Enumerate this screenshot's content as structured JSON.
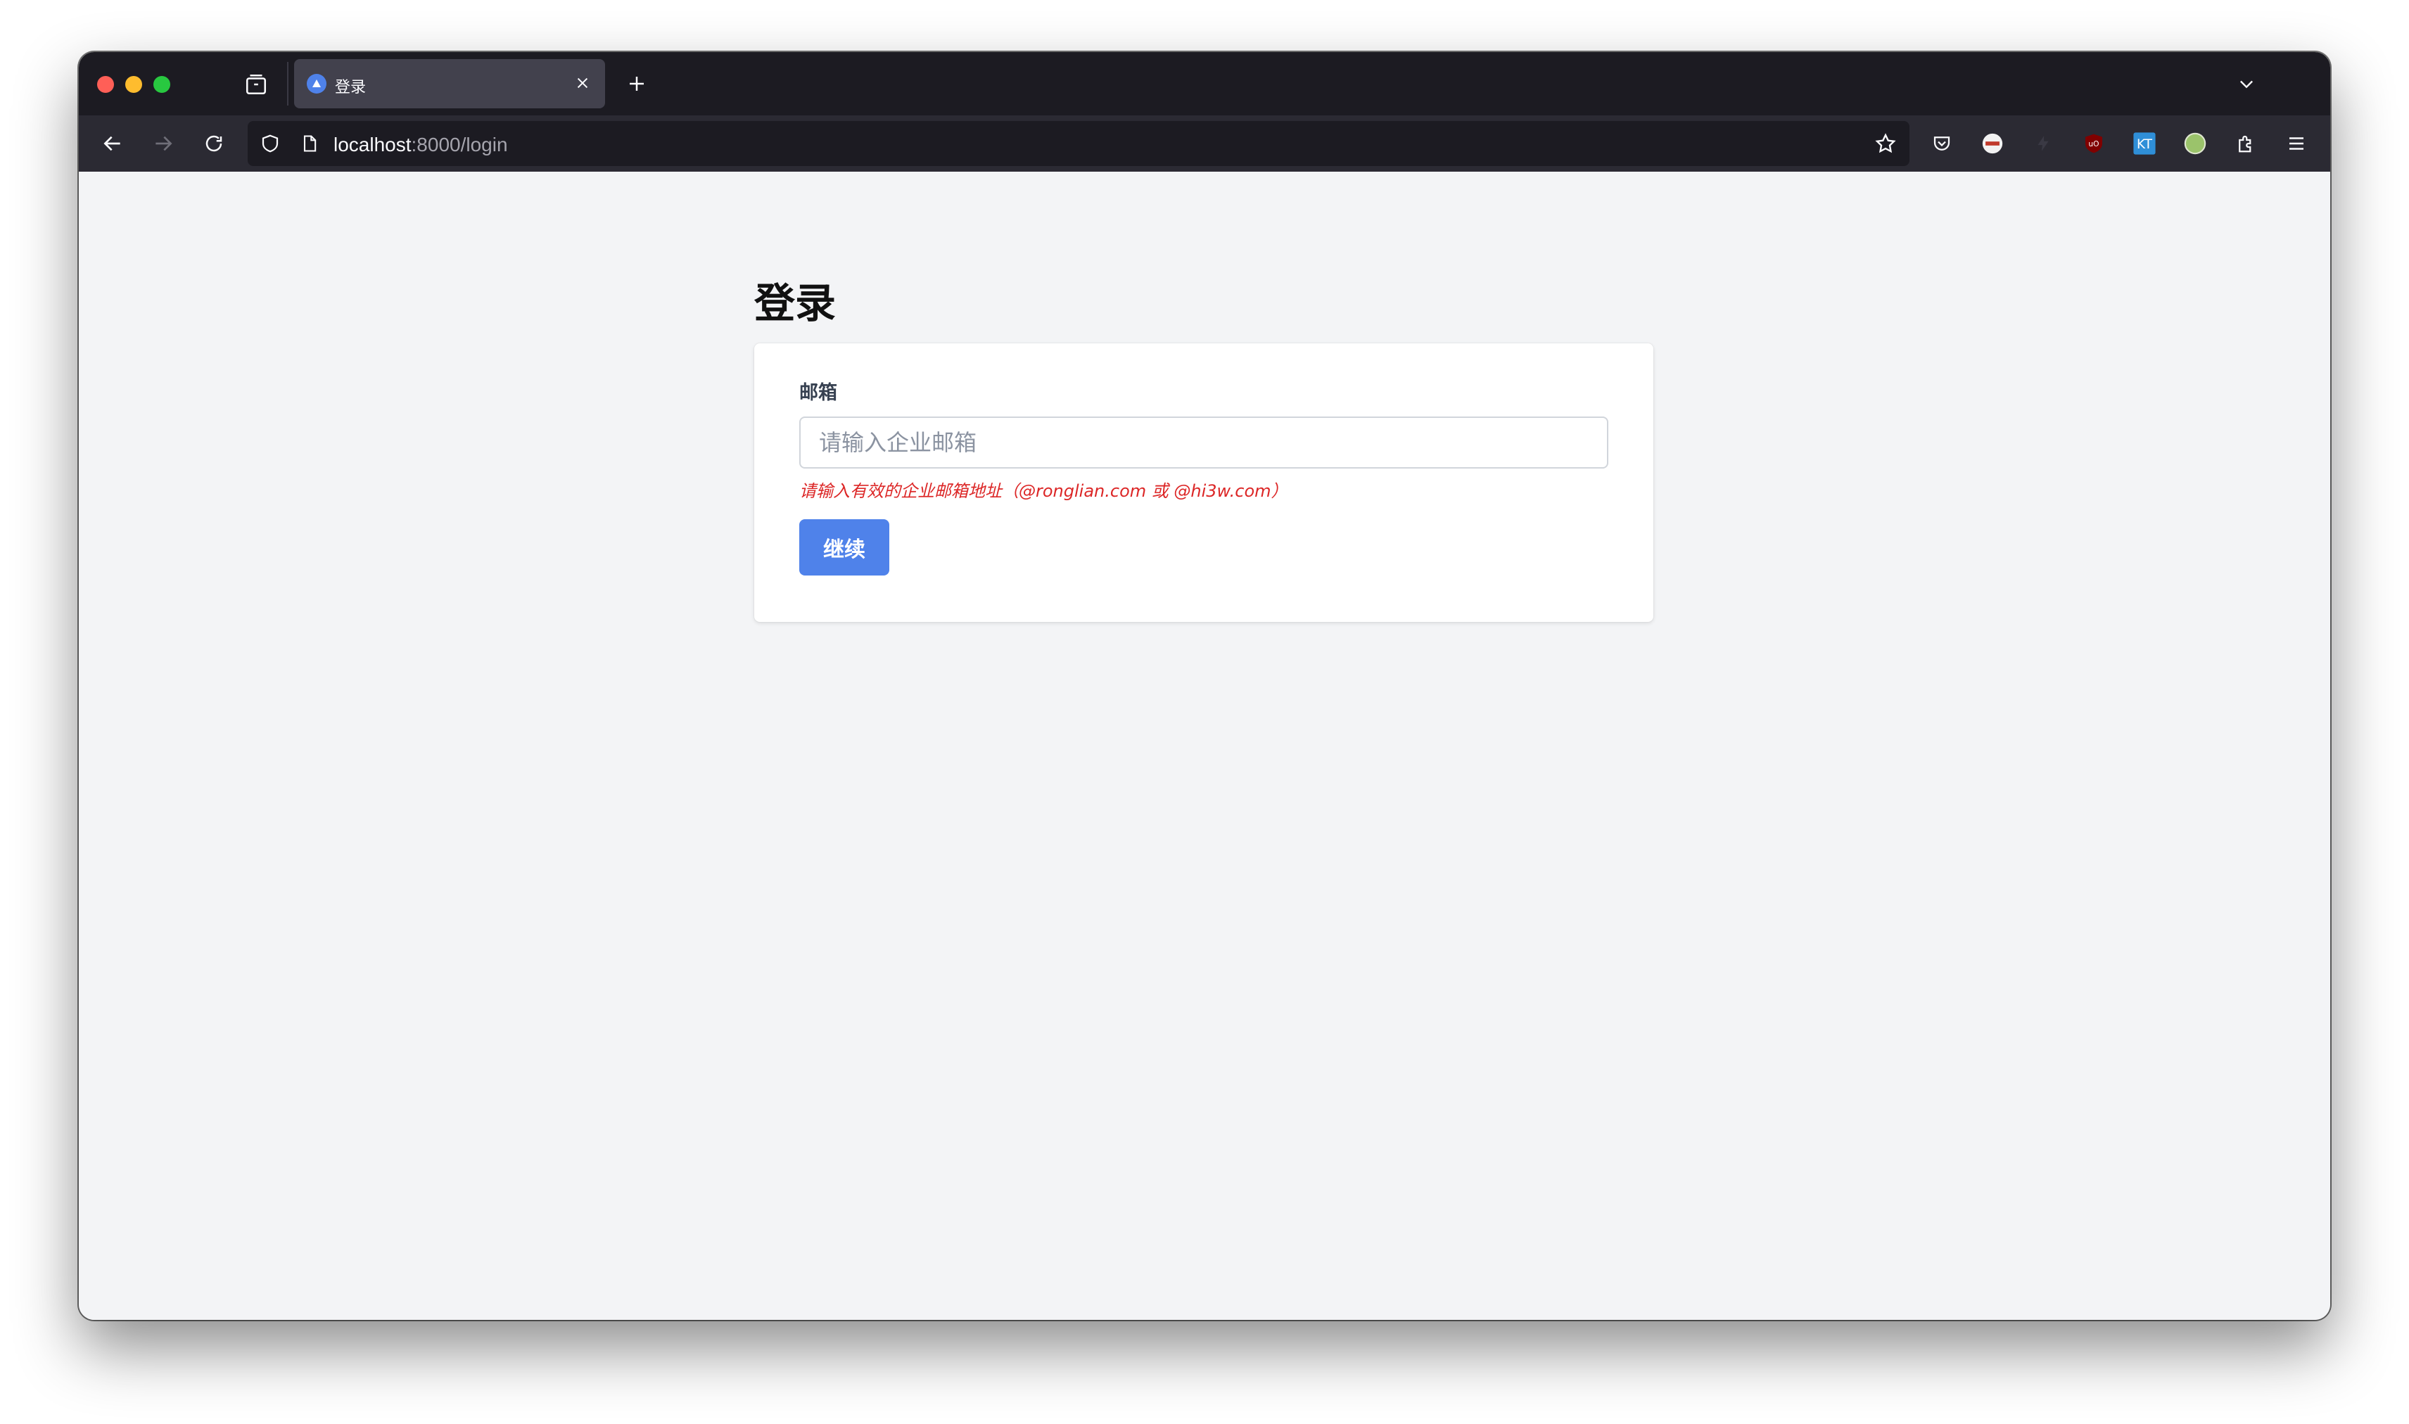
{
  "browser": {
    "tab": {
      "title": "登录",
      "favicon": "triangle-logo-icon"
    },
    "url": {
      "host": "localhost",
      "rest": ":8000/login"
    },
    "toolbar_icons": [
      "back-arrow-icon",
      "forward-arrow-icon",
      "reload-icon",
      "bookmark-star-icon",
      "pocket-icon",
      "extension-icon",
      "ublock-icon",
      "kt-extension-icon",
      "puzzle-extensions-icon",
      "hamburger-menu-icon"
    ]
  },
  "page": {
    "title": "登录",
    "form": {
      "email_label": "邮箱",
      "email_placeholder": "请输入企业邮箱",
      "error_message": "请输入有效的企业邮箱地址（@ronglian.com 或 @hi3w.com）",
      "submit_label": "继续"
    }
  },
  "colors": {
    "accent": "#4f82ea",
    "error": "#dc2626",
    "page_bg": "#f3f4f6"
  }
}
